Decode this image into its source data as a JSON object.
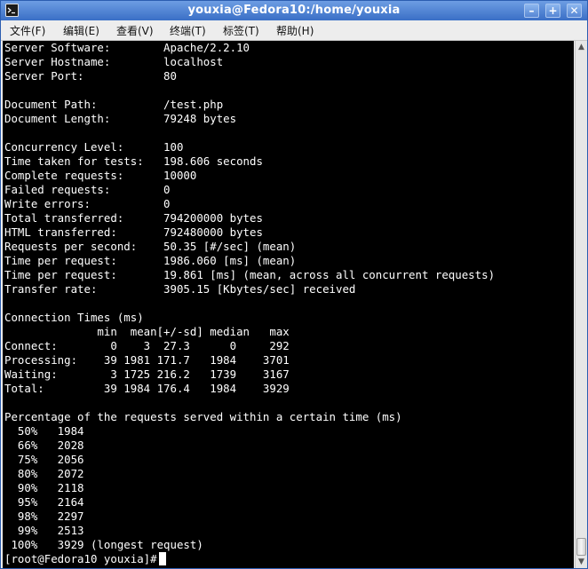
{
  "window": {
    "title": "youxia@Fedora10:/home/youxia",
    "buttons": {
      "minimize": "–",
      "maximize": "+",
      "close": "✕"
    }
  },
  "menu": {
    "file": "文件(F)",
    "edit": "编辑(E)",
    "view": "查看(V)",
    "terminal": "终端(T)",
    "tabs": "标签(T)",
    "help": "帮助(H)"
  },
  "terminal": {
    "output": "Server Software:        Apache/2.2.10\nServer Hostname:        localhost\nServer Port:            80\n\nDocument Path:          /test.php\nDocument Length:        79248 bytes\n\nConcurrency Level:      100\nTime taken for tests:   198.606 seconds\nComplete requests:      10000\nFailed requests:        0\nWrite errors:           0\nTotal transferred:      794200000 bytes\nHTML transferred:       792480000 bytes\nRequests per second:    50.35 [#/sec] (mean)\nTime per request:       1986.060 [ms] (mean)\nTime per request:       19.861 [ms] (mean, across all concurrent requests)\nTransfer rate:          3905.15 [Kbytes/sec] received\n\nConnection Times (ms)\n              min  mean[+/-sd] median   max\nConnect:        0    3  27.3      0     292\nProcessing:    39 1981 171.7   1984    3701\nWaiting:        3 1725 216.2   1739    3167\nTotal:         39 1984 176.4   1984    3929\n\nPercentage of the requests served within a certain time (ms)\n  50%   1984\n  66%   2028\n  75%   2056\n  80%   2072\n  90%   2118\n  95%   2164\n  98%   2297\n  99%   2513\n 100%   3929 (longest request)",
    "prompt": "[root@Fedora10 youxia]#"
  },
  "icons": {
    "title": "terminal-icon",
    "scroll_up": "▲",
    "scroll_down": "▼"
  }
}
